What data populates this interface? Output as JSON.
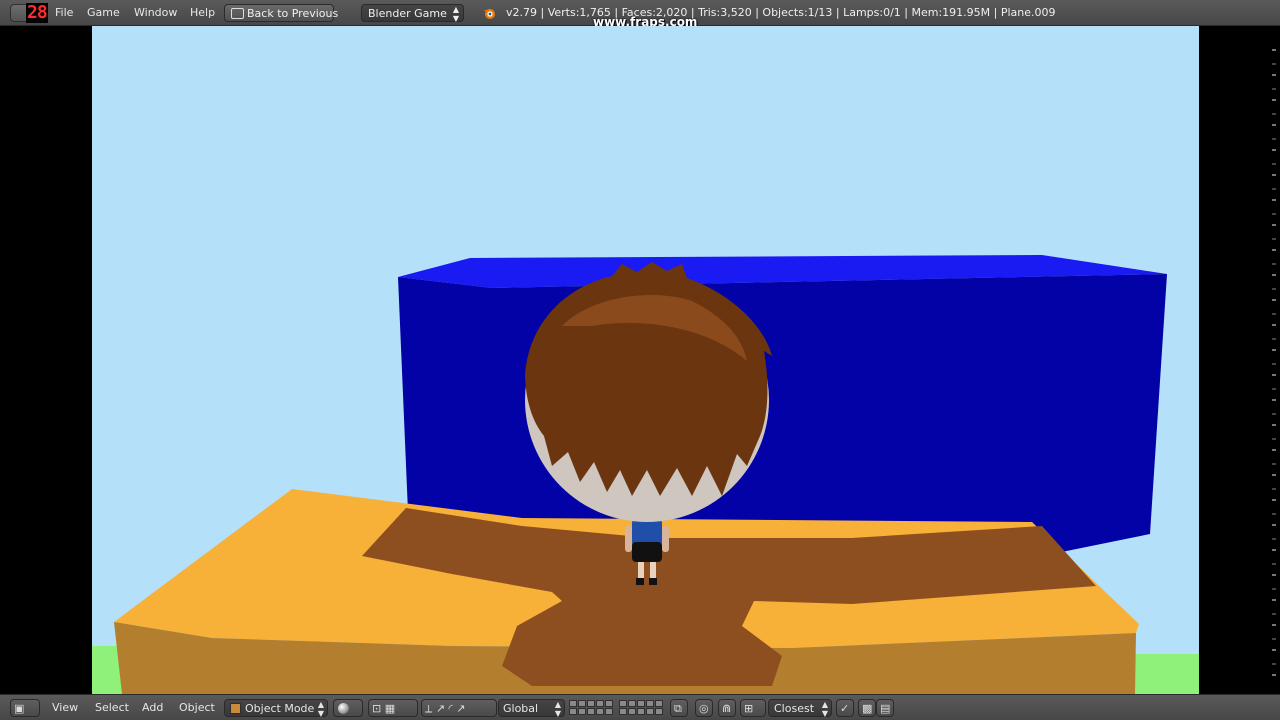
{
  "top_header": {
    "fraps_counter": "28",
    "menus": [
      "File",
      "Game",
      "Window",
      "Help"
    ],
    "back_button": "Back to Previous",
    "engine": "Blender Game",
    "stats": "v2.79 | Verts:1,765 | Faces:2,020 | Tris:3,520 | Objects:1/13 | Lamps:0/1 | Mem:191.95M | Plane.009",
    "watermark": "www.fraps.com"
  },
  "viewport": {
    "description_objects": [
      "blue-wall",
      "orange-platform",
      "green-ground",
      "character"
    ],
    "colors": {
      "sky": "#b5e0fa",
      "wall_front": "#0000a8",
      "wall_top": "#1818f0",
      "platform_top": "#f7b038",
      "platform_side": "#b37f2e",
      "shadow": "#8e4f20",
      "grass": "#8ff07a",
      "hair": "#6b3510"
    }
  },
  "bottom_header": {
    "menus": [
      "View",
      "Select",
      "Add",
      "Object"
    ],
    "mode": "Object Mode",
    "orientation": "Global",
    "snap_target": "Closest"
  }
}
